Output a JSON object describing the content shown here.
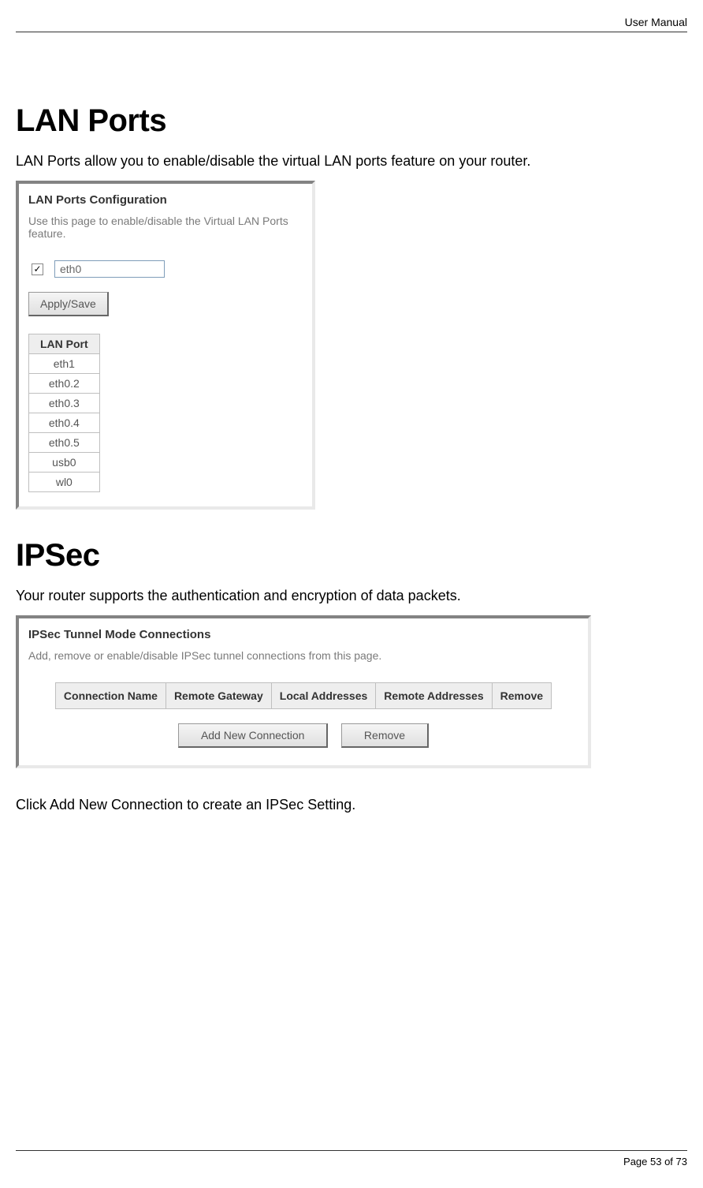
{
  "header": {
    "title": "User Manual"
  },
  "lan": {
    "heading": "LAN Ports",
    "intro": "LAN Ports allow you to enable/disable the virtual LAN ports feature on your router.",
    "panel_title": "LAN Ports Configuration",
    "panel_sub": "Use this page to enable/disable the Virtual LAN Ports feature.",
    "checkbox_checked": true,
    "input_value": "eth0",
    "apply_label": "Apply/Save",
    "table_header": "LAN Port",
    "ports": [
      "eth1",
      "eth0.2",
      "eth0.3",
      "eth0.4",
      "eth0.5",
      "usb0",
      "wl0"
    ]
  },
  "ipsec": {
    "heading": "IPSec",
    "intro": "Your router supports the authentication and encryption of data packets.",
    "panel_title": "IPSec Tunnel Mode Connections",
    "panel_sub": "Add, remove or enable/disable IPSec tunnel connections from this page.",
    "columns": [
      "Connection Name",
      "Remote Gateway",
      "Local Addresses",
      "Remote Addresses",
      "Remove"
    ],
    "add_label": "Add New Connection",
    "remove_label": "Remove",
    "after": "Click Add New Connection to create an IPSec Setting."
  },
  "footer": {
    "page_label": "Page 53",
    "of_label": " of 73"
  }
}
